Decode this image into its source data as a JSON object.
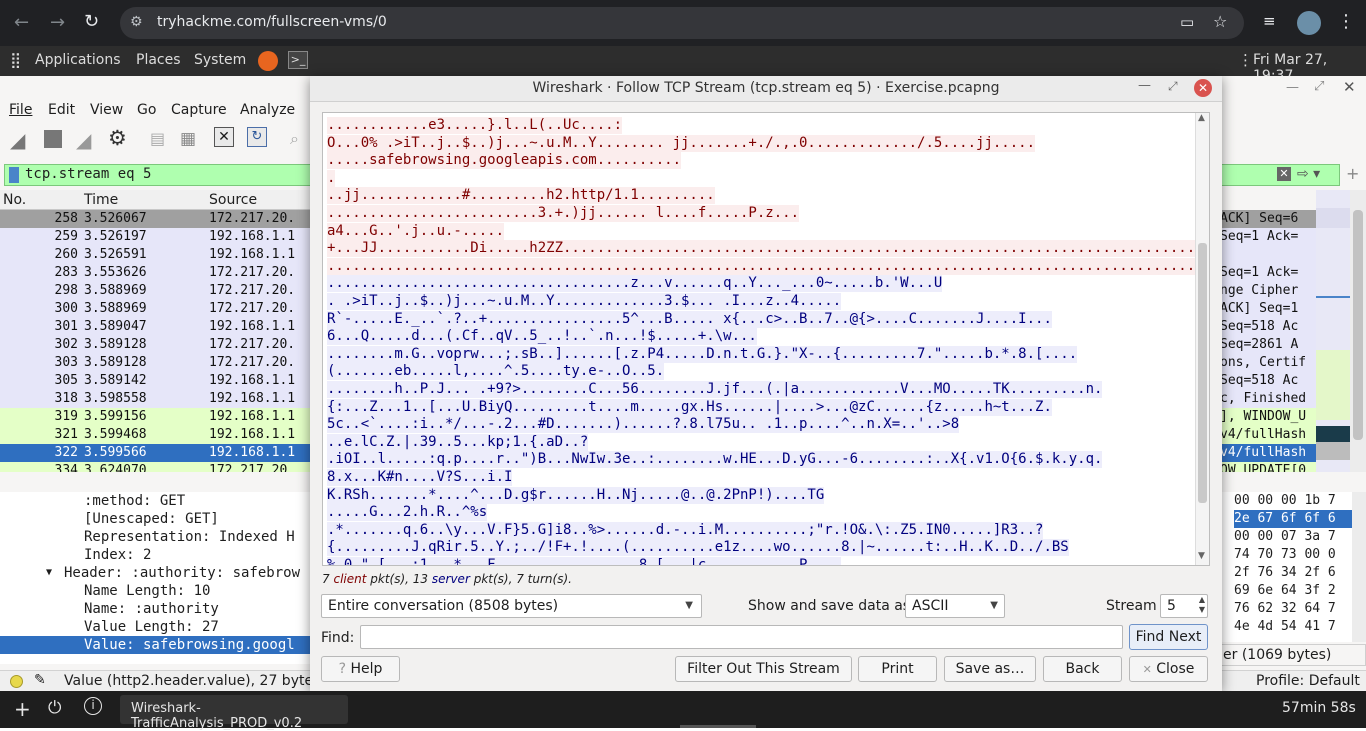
{
  "browser": {
    "url": "tryhackme.com/fullscreen-vms/0"
  },
  "gnome": {
    "applications": "Applications",
    "places": "Places",
    "system": "System",
    "clock": "Fri Mar 27, 19:37"
  },
  "wireshark": {
    "menu": [
      "File",
      "Edit",
      "View",
      "Go",
      "Capture",
      "Analyze"
    ],
    "filter": "tcp.stream eq 5",
    "columns": {
      "no": "No.",
      "time": "Time",
      "source": "Source"
    },
    "packets": [
      {
        "no": "258",
        "time": "3.526067",
        "src": "172.217.20.",
        "info": "ACK] Seq=6"
      },
      {
        "no": "259",
        "time": "3.526197",
        "src": "192.168.1.1",
        "info": "Seq=1 Ack="
      },
      {
        "no": "260",
        "time": "3.526591",
        "src": "192.168.1.1",
        "info": ""
      },
      {
        "no": "283",
        "time": "3.553626",
        "src": "172.217.20.",
        "info": "Seq=1 Ack="
      },
      {
        "no": "298",
        "time": "3.588969",
        "src": "172.217.20.",
        "info": "nge Cipher "
      },
      {
        "no": "300",
        "time": "3.588969",
        "src": "172.217.20.",
        "info": "ACK] Seq=1"
      },
      {
        "no": "301",
        "time": "3.589047",
        "src": "192.168.1.1",
        "info": "Seq=518 Ac"
      },
      {
        "no": "302",
        "time": "3.589128",
        "src": "172.217.20.",
        "info": "Seq=2861 A"
      },
      {
        "no": "303",
        "time": "3.589128",
        "src": "172.217.20.",
        "info": "ons, Certif"
      },
      {
        "no": "305",
        "time": "3.589142",
        "src": "192.168.1.1",
        "info": "Seq=518 Ac"
      },
      {
        "no": "318",
        "time": "3.598558",
        "src": "192.168.1.1",
        "info": "c, Finished"
      },
      {
        "no": "319",
        "time": "3.599156",
        "src": "192.168.1.1",
        "info": "], WINDOW_U"
      },
      {
        "no": "321",
        "time": "3.599468",
        "src": "192.168.1.1",
        "info": "v4/fullHash"
      },
      {
        "no": "322",
        "time": "3.599566",
        "src": "192.168.1.1",
        "info": "v4/fullHash"
      },
      {
        "no": "334",
        "time": "3.624070",
        "src": "172.217.20.",
        "info": "OW_UPDATE[0"
      }
    ],
    "details": [
      ":method: GET",
      "[Unescaped: GET]",
      "Representation: Indexed H",
      "Index: 2",
      "Header: :authority: safebrow",
      "Name Length: 10",
      "Name: :authority",
      "Value Length: 27",
      "Value: safebrowsing.googl"
    ],
    "hex": [
      "00 00 00 1b 7",
      "2e 67 6f 6f 6",
      "00 00 07 3a 7",
      "74 70 73 00 0",
      "2f 76 34 2f 6",
      "69 6e 64 3f 2",
      "76 62 32 64 7",
      "4e 4d 54 41 7"
    ],
    "bytes_tab": "er (1069 bytes)",
    "status": "Value (http2.header.value), 27 byte(s)",
    "profile": "Profile: Default"
  },
  "dialog": {
    "title": "Wireshark · Follow TCP Stream (tcp.stream eq 5) · Exercise.pcapng",
    "stream_lines": [
      {
        "t": "c",
        "s": "............e3.....}.l..L(..Uc....:"
      },
      {
        "t": "c",
        "s": "O...0% .>iT..j..$..)j...~.u.M..Y........ jj.......+./.,.0............./.5....jj....."
      },
      {
        "t": "c",
        "s": ".....safebrowsing.googleapis.com.........."
      },
      {
        "t": "c",
        "s": "."
      },
      {
        "t": "c",
        "s": "..jj............#.........h2.http/1.1........."
      },
      {
        "t": "c",
        "s": ".........................3.+.)jj...... l....f.....P.z..."
      },
      {
        "t": "c",
        "s": "a4...G..'.j..u.-....."
      },
      {
        "t": "c",
        "s": "+...JJ...........Di.....h2ZZ..............................................................................."
      },
      {
        "t": "c",
        "s": "..............................................................................................................."
      },
      {
        "t": "s",
        "s": "....................................z...v......q..Y..._...0~.....b.'W...U"
      },
      {
        "t": "s",
        "s": ". .>iT..j..$..)j...~.u.M..Y.............3.$... .I...z..4....."
      },
      {
        "t": "s",
        "s": "R`-.....E._..`.?..+................5^...B..... x{...c>..B..7..@{>....C.......J....I..."
      },
      {
        "t": "s",
        "s": "6...Q.....d...(.Cf..qV..5_..!..`.n...!$.....+.\\w..."
      },
      {
        "t": "s",
        "s": "........m.G..voprw...;.sB..]......[.z.P4.....D.n.t.G.}.\"X-..{.........7.\".....b.*.8.[...."
      },
      {
        "t": "s",
        "s": "(.......eb.....l,....^.5....ty.e-..O..5."
      },
      {
        "t": "s",
        "s": "........h..P.J... .+9?>........C...56........J.jf...(.|a............V...MO.....TK.........n."
      },
      {
        "t": "s",
        "s": "{:...Z...1..[...U.BiyQ.........t....m.....gx.Hs......|....>...@zC......{z.....h~t...Z."
      },
      {
        "t": "s",
        "s": "5c..<`....:i..*/...-.2...#D.......)......?.8.l75u.. .1..p....^..n.X=..'..>8"
      },
      {
        "t": "s",
        "s": "..e.lC.Z.|.39..5...kp;1.{.aD..?"
      },
      {
        "t": "s",
        "s": ".iOI..l.....:q.p....r..\")B...NwIw.3e..:........w.HE...D.yG...-6........:..X{.v1.O{6.$.k.y.q."
      },
      {
        "t": "s",
        "s": "8.x...K#n....V?S...i.I"
      },
      {
        "t": "s",
        "s": "K.RSh.......*....^...D.g$r......H..Nj.....@..@.2PnP!)....TG"
      },
      {
        "t": "s",
        "s": ".....G...2.h.R..^%s"
      },
      {
        "t": "s",
        "s": ".*.......q.6..\\y...V.F}5.G]i8..%>......d.-..i.M..........;\"r.!O&.\\:.Z5.IN0.....]R3..?"
      },
      {
        "t": "s",
        "s": "{.........J.qRir.5..Y.;../!F+.!....(..........e1z....wo......8.|~......t:..H..K..D../.BS"
      },
      {
        "t": "s",
        "s": "% 0 \" [ . :1 . * . F . . . . . . . . 8 [ . |c . . . . . P . ."
      }
    ],
    "summary_client_count": "7",
    "summary_client": "client",
    "summary_mid": "pkt(s), 13",
    "summary_server": "server",
    "summary_end": "pkt(s), 7 turn(s).",
    "conversation": "Entire conversation (8508 bytes)",
    "show_as_label": "Show and save data as",
    "show_as": "ASCII",
    "stream_label": "Stream",
    "stream_value": "5",
    "find_label": "Find:",
    "find_value": "",
    "find_next": "Find Next",
    "help": "Help",
    "filter_out": "Filter Out This Stream",
    "print": "Print",
    "save_as": "Save as…",
    "back": "Back",
    "close": "Close"
  },
  "taskbar": {
    "task": "Wireshark-TrafficAnalysis_PROD_v0.2",
    "timer": "57min 58s"
  }
}
